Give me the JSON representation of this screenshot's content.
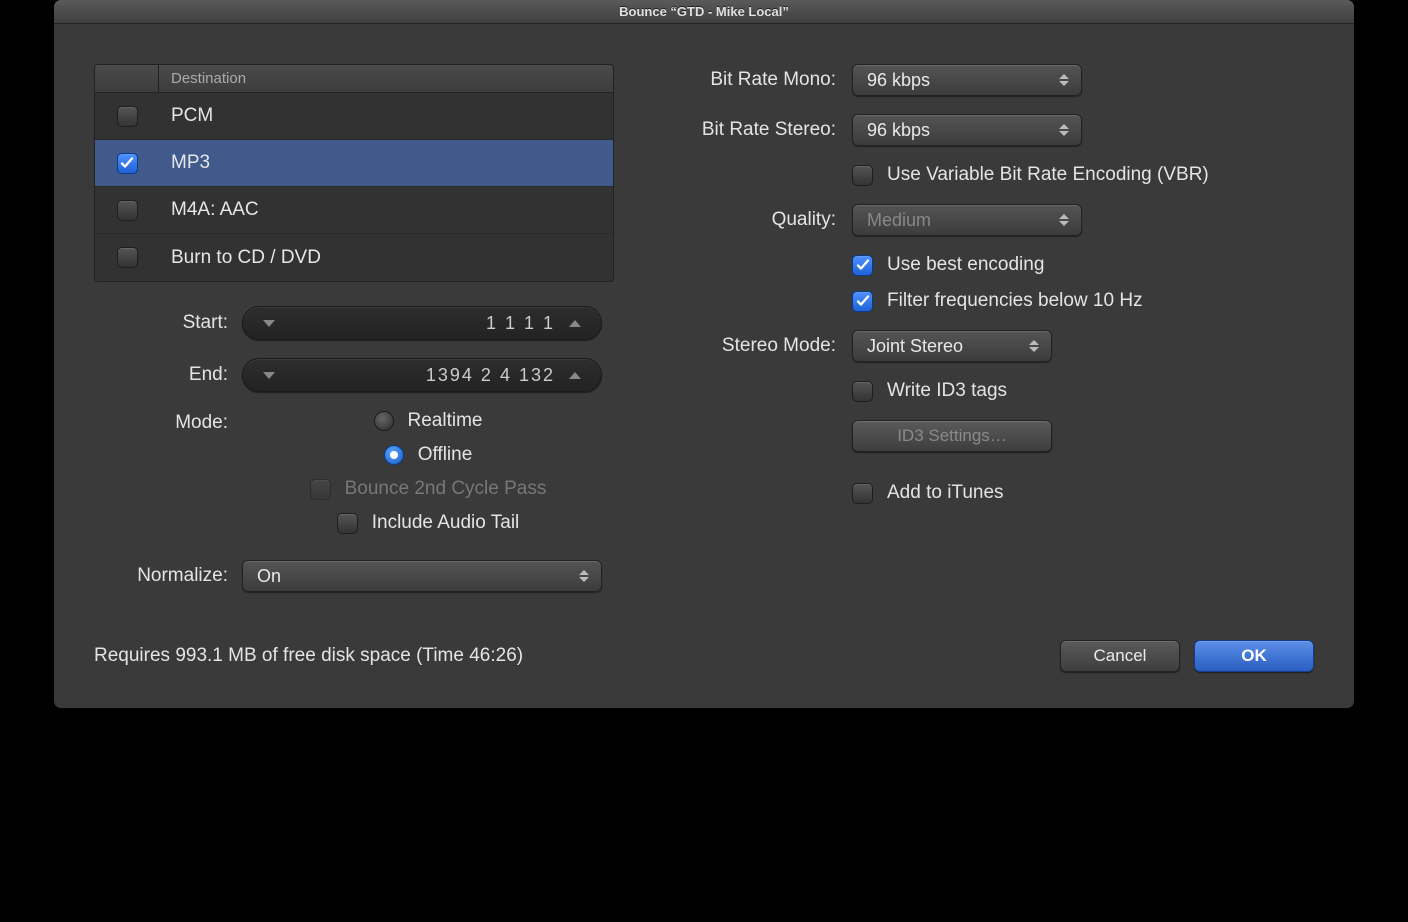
{
  "window": {
    "title": "Bounce “GTD - Mike Local”"
  },
  "destination": {
    "header": "Destination",
    "items": [
      {
        "label": "PCM",
        "checked": false,
        "selected": false
      },
      {
        "label": "MP3",
        "checked": true,
        "selected": true
      },
      {
        "label": "M4A: AAC",
        "checked": false,
        "selected": false
      },
      {
        "label": "Burn to CD / DVD",
        "checked": false,
        "selected": false
      }
    ]
  },
  "left": {
    "start_label": "Start:",
    "start_value": "1 1 1     1",
    "end_label": "End:",
    "end_value": "1394 2 4 132",
    "mode_label": "Mode:",
    "mode_realtime": "Realtime",
    "mode_offline": "Offline",
    "mode_selected": "offline",
    "bounce_2nd": "Bounce 2nd Cycle Pass",
    "include_tail": "Include Audio Tail",
    "normalize_label": "Normalize:",
    "normalize_value": "On"
  },
  "right": {
    "bitrate_mono_label": "Bit Rate Mono:",
    "bitrate_mono_value": "96 kbps",
    "bitrate_stereo_label": "Bit Rate Stereo:",
    "bitrate_stereo_value": "96 kbps",
    "vbr_label": "Use Variable Bit Rate Encoding (VBR)",
    "quality_label": "Quality:",
    "quality_value": "Medium",
    "best_encoding": "Use best encoding",
    "filter_freq": "Filter frequencies below 10 Hz",
    "stereo_mode_label": "Stereo Mode:",
    "stereo_mode_value": "Joint Stereo",
    "write_id3": "Write ID3 tags",
    "id3_settings": "ID3 Settings…",
    "add_itunes": "Add to iTunes"
  },
  "footer": {
    "status": "Requires 993.1 MB of free disk space  (Time 46:26)",
    "cancel": "Cancel",
    "ok": "OK"
  }
}
